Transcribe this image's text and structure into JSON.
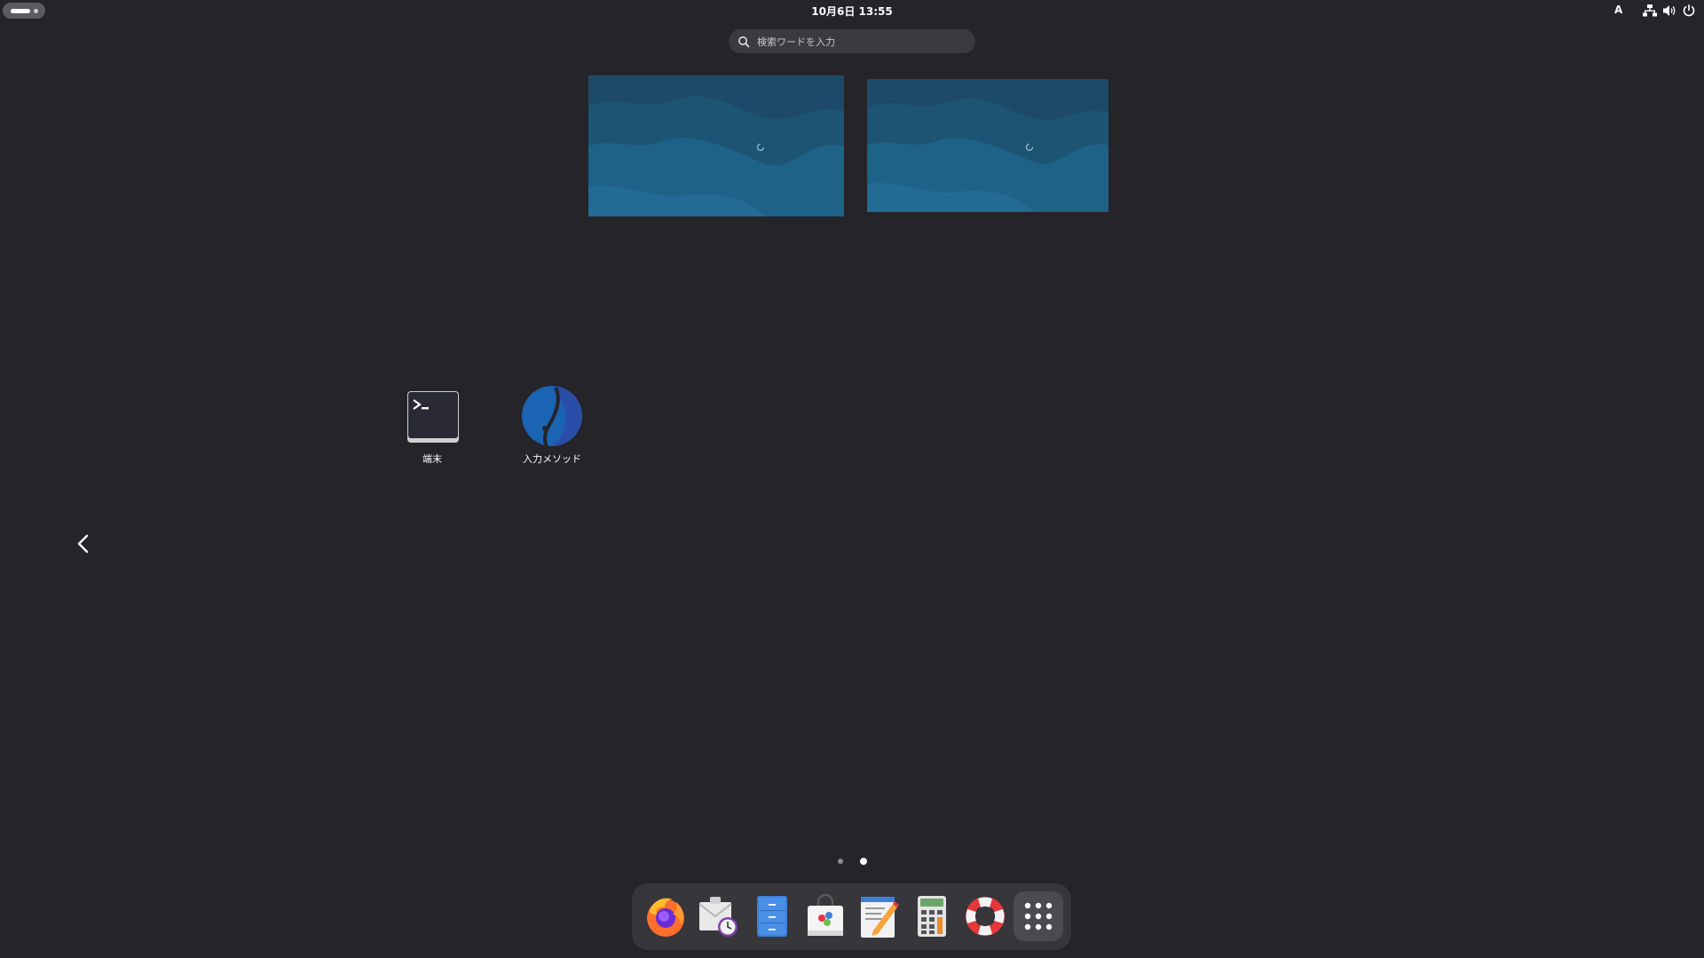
{
  "topbar": {
    "clock": "10月6日  13:55",
    "input_method": "A"
  },
  "search": {
    "placeholder": "検索ワードを入力"
  },
  "apps": [
    {
      "label": "端末",
      "icon": "terminal-icon"
    },
    {
      "label": "入力メソッド",
      "icon": "input-method-icon"
    }
  ],
  "pages": {
    "count": 2,
    "current": 2
  },
  "dash": {
    "items": [
      "firefox-icon",
      "evolution-mail-icon",
      "files-icon",
      "software-store-icon",
      "text-editor-icon",
      "calculator-icon",
      "help-icon",
      "show-apps-icon"
    ]
  },
  "colors": {
    "background": "#242429",
    "wallpaper": "#1f5f86",
    "dash": "#36363b"
  }
}
